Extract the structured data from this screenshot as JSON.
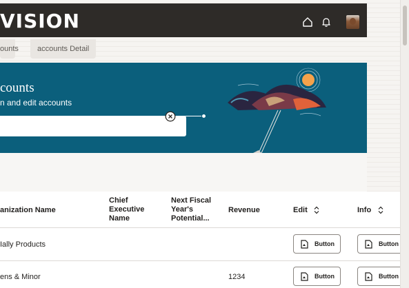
{
  "app": {
    "brand": "VISION"
  },
  "header": {
    "icons": [
      "home-icon",
      "bell-icon"
    ],
    "avatar": "user-avatar"
  },
  "tabs": [
    {
      "label": "ounts"
    },
    {
      "label": "accounts Detail"
    }
  ],
  "banner": {
    "title": "counts",
    "subtitle": "n and edit accounts",
    "search": {
      "value": "",
      "placeholder": ""
    },
    "bg_color": "#0b5f7c"
  },
  "table": {
    "headers": {
      "org_name": "anization Name",
      "ceo": "Chief Executive Name",
      "fiscal": "Next Fiscal Year's Potential...",
      "revenue": "Revenue",
      "edit": "Edit",
      "info": "Info"
    },
    "rows": [
      {
        "org_name": "Ially Products",
        "ceo": "",
        "fiscal": "",
        "revenue": "",
        "edit_label": "Button",
        "info_label": "Button"
      },
      {
        "org_name": "ens & Minor",
        "ceo": "",
        "fiscal": "",
        "revenue": "1234",
        "edit_label": "Button",
        "info_label": "Button"
      }
    ]
  }
}
